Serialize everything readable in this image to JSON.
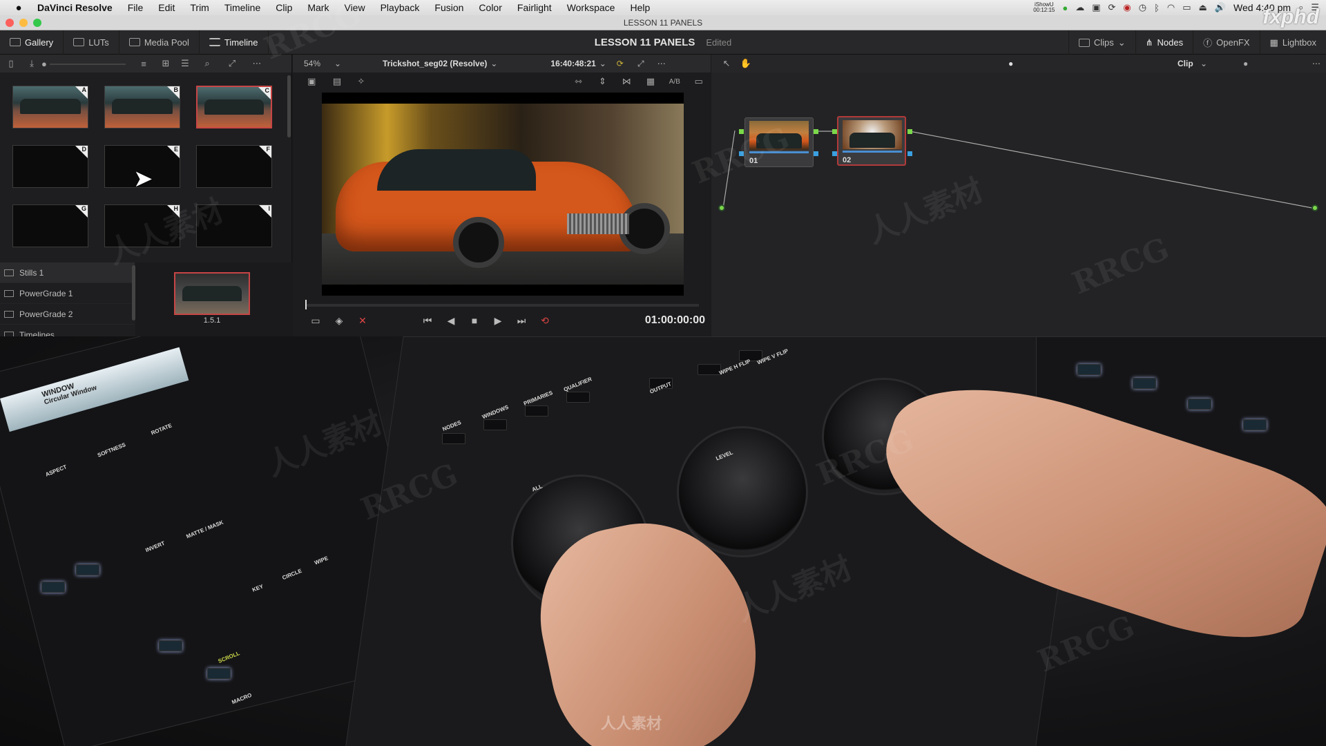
{
  "menubar": {
    "app_name": "DaVinci Resolve",
    "items": [
      "File",
      "Edit",
      "Trim",
      "Timeline",
      "Clip",
      "Mark",
      "View",
      "Playback",
      "Fusion",
      "Color",
      "Fairlight",
      "Workspace",
      "Help"
    ],
    "recorder_label": "iShowU",
    "recorder_time": "00:12:15",
    "clock": "Wed 4:40 pm"
  },
  "window": {
    "title": "LESSON 11 PANELS"
  },
  "toolbar": {
    "gallery": "Gallery",
    "luts": "LUTs",
    "media_pool": "Media Pool",
    "timeline": "Timeline",
    "project_name": "LESSON 11 PANELS",
    "status": "Edited",
    "clips": "Clips",
    "nodes": "Nodes",
    "openfx": "OpenFX",
    "lightbox": "Lightbox"
  },
  "viewer": {
    "zoom": "54%",
    "clip_name": "Trickshot_seg02 (Resolve)",
    "source_timecode": "16:40:48:21",
    "timecode": "01:00:00:00",
    "ab_label": "A/B"
  },
  "nodes_panel": {
    "mode": "Clip",
    "node1_label": "01",
    "node2_label": "02"
  },
  "gallery": {
    "stills": [
      {
        "letter": "A",
        "filled": true,
        "selected": false
      },
      {
        "letter": "B",
        "filled": true,
        "selected": false
      },
      {
        "letter": "C",
        "filled": true,
        "selected": true
      },
      {
        "letter": "D",
        "filled": false,
        "selected": false
      },
      {
        "letter": "E",
        "filled": false,
        "selected": false
      },
      {
        "letter": "F",
        "filled": false,
        "selected": false
      },
      {
        "letter": "G",
        "filled": false,
        "selected": false
      },
      {
        "letter": "H",
        "filled": false,
        "selected": false
      },
      {
        "letter": "I",
        "filled": false,
        "selected": false
      }
    ],
    "albums": [
      "Stills 1",
      "PowerGrade 1",
      "PowerGrade 2",
      "Timelines"
    ],
    "powergrade_still_label": "1.5.1"
  },
  "photo": {
    "panel_window_title": "WINDOW",
    "panel_window_subtitle": "Circular Window",
    "key_labels": [
      "ASPECT",
      "SOFTNESS",
      "ROTATE",
      "INVERT",
      "MATTE / MASK",
      "NODES",
      "WINDOWS",
      "PRIMARIES",
      "QUALIFIER",
      "OUTPUT",
      "WIPE H FLIP",
      "WIPE V FLIP",
      "KEY",
      "CIRCLE",
      "WIPE",
      "SCROLL",
      "MACRO",
      "LEVEL",
      "ALL"
    ],
    "watermark_text": "RRCG",
    "watermark_cn": "人人素材",
    "brand": "fxphd"
  },
  "colors": {
    "accent_red": "#c84545",
    "node_green": "#7bd84a",
    "node_blue": "#3aa0e0",
    "car_orange": "#d4571b"
  }
}
